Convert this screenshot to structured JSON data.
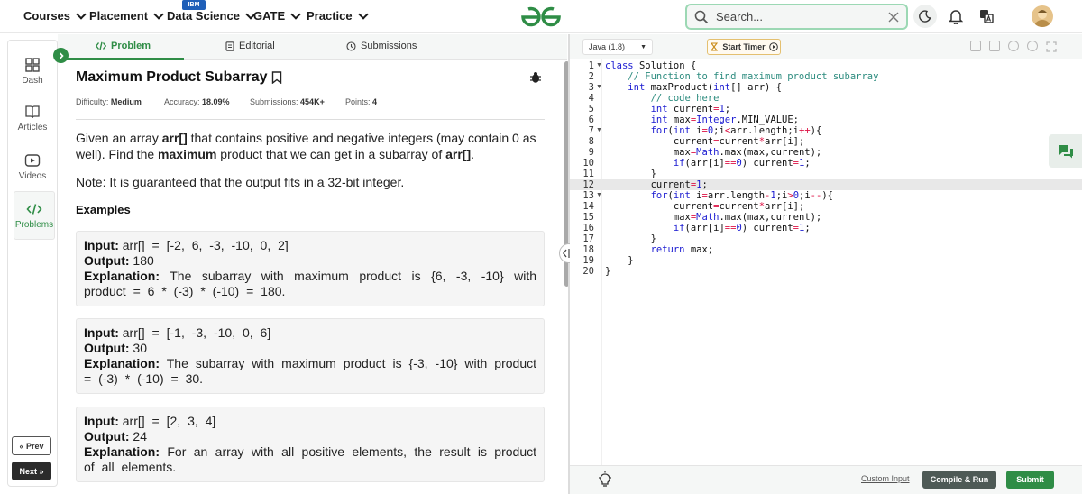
{
  "nav": {
    "items": [
      {
        "label": "Courses"
      },
      {
        "label": "Placement"
      },
      {
        "label": "Data Science",
        "badge": "IBM"
      },
      {
        "label": "GATE"
      },
      {
        "label": "Practice"
      }
    ],
    "search_placeholder": "Search..."
  },
  "sidebar": {
    "items": [
      {
        "label": "Dash",
        "icon": "dashboard-icon"
      },
      {
        "label": "Articles",
        "icon": "book-icon"
      },
      {
        "label": "Videos",
        "icon": "video-icon"
      },
      {
        "label": "Problems",
        "icon": "code-icon",
        "active": true
      }
    ],
    "prev_label": "Prev",
    "next_label": "Next"
  },
  "tabs": [
    {
      "label": "Problem",
      "active": true
    },
    {
      "label": "Editorial"
    },
    {
      "label": "Submissions"
    }
  ],
  "problem": {
    "title": "Maximum Product Subarray",
    "difficulty_label": "Difficulty:",
    "difficulty": "Medium",
    "accuracy_label": "Accuracy:",
    "accuracy": "18.09%",
    "submissions_label": "Submissions:",
    "submissions": "454K+",
    "points_label": "Points:",
    "points": "4",
    "desc_1": "Given an array ",
    "desc_arr": "arr[]",
    "desc_2": " that contains positive and negative integers (may contain 0 as well). Find the ",
    "desc_max": "maximum",
    "desc_3": " product that we can get in a subarray of ",
    "desc_arr2": "arr[]",
    "desc_4": ".",
    "note": "Note: It is guaranteed that the output fits in a 32-bit integer.",
    "examples_heading": "Examples",
    "examples": [
      {
        "input": "arr[] = [-2, 6, -3, -10, 0, 2]",
        "output": "180",
        "explanation": "The subarray with maximum product is {6, -3, -10} with product = 6 * (-3) * (-10) = 180."
      },
      {
        "input": "arr[] = [-1, -3, -10, 0, 6]",
        "output": "30",
        "explanation": "The subarray with maximum product is {-3, -10} with product = (-3) * (-10) = 30."
      },
      {
        "input": "arr[] = [2, 3, 4]",
        "output": "24",
        "explanation": "For an array with all positive elements, the result is product of all elements."
      }
    ],
    "input_label": "Input:",
    "output_label": "Output:",
    "explanation_label": "Explanation:"
  },
  "editor": {
    "language": "Java (1.8)",
    "timer_label": "Start Timer",
    "line_numbers": [
      "1",
      "2",
      "3",
      "4",
      "5",
      "6",
      "7",
      "8",
      "9",
      "10",
      "11",
      "12",
      "13",
      "14",
      "15",
      "16",
      "17",
      "18",
      "19",
      "20"
    ],
    "custom_input_label": "Custom Input",
    "compile_label": "Compile & Run",
    "submit_label": "Submit"
  },
  "colors": {
    "brand_green": "#2f8d46",
    "keyword_blue": "#1b1bd1",
    "comment_teal": "#2b8b7e"
  }
}
